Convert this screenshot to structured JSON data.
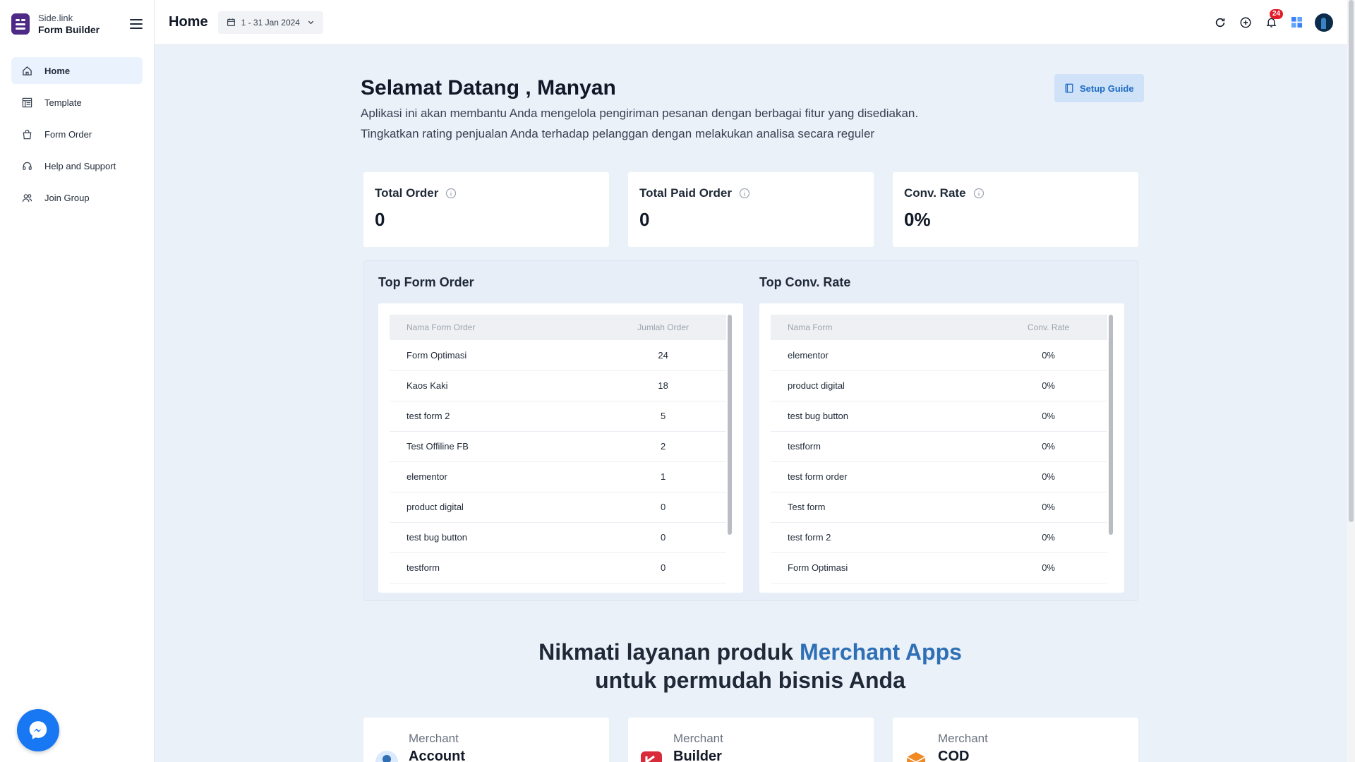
{
  "brand": {
    "line1": "Side.link",
    "line2": "Form Builder"
  },
  "sidebar": {
    "items": [
      {
        "label": "Home",
        "icon": "home-icon",
        "active": true
      },
      {
        "label": "Template",
        "icon": "template-icon"
      },
      {
        "label": "Form Order",
        "icon": "shopping-bag-icon"
      },
      {
        "label": "Help and Support",
        "icon": "headset-icon"
      },
      {
        "label": "Join Group",
        "icon": "users-icon"
      }
    ]
  },
  "header": {
    "title": "Home",
    "date_range": "1 - 31 Jan 2024",
    "notification_count": "24",
    "icons": [
      "refresh-icon",
      "plus-circle-icon",
      "bell-icon",
      "apps-grid-icon",
      "avatar"
    ]
  },
  "welcome": {
    "title": "Selamat Datang , Manyan",
    "line1": "Aplikasi ini akan membantu Anda mengelola pengiriman pesanan dengan berbagai fitur yang disediakan.",
    "line2": "Tingkatkan rating penjualan Anda terhadap pelanggan dengan melakukan analisa secara reguler",
    "setup_guide": "Setup Guide"
  },
  "stats": [
    {
      "label": "Total Order",
      "value": "0"
    },
    {
      "label": "Total Paid Order",
      "value": "0"
    },
    {
      "label": "Conv. Rate",
      "value": "0%"
    }
  ],
  "top_form_order": {
    "title": "Top Form Order",
    "columns": [
      "Nama Form Order",
      "Jumlah Order"
    ],
    "rows": [
      [
        "Form Optimasi",
        "24"
      ],
      [
        "Kaos Kaki",
        "18"
      ],
      [
        "test form 2",
        "5"
      ],
      [
        "Test Offiline FB",
        "2"
      ],
      [
        "elementor",
        "1"
      ],
      [
        "product digital",
        "0"
      ],
      [
        "test bug button",
        "0"
      ],
      [
        "testform",
        "0"
      ]
    ]
  },
  "top_conv_rate": {
    "title": "Top Conv. Rate",
    "columns": [
      "Nama Form",
      "Conv. Rate"
    ],
    "rows": [
      [
        "elementor",
        "0%"
      ],
      [
        "product digital",
        "0%"
      ],
      [
        "test bug button",
        "0%"
      ],
      [
        "testform",
        "0%"
      ],
      [
        "test form order",
        "0%"
      ],
      [
        "Test form",
        "0%"
      ],
      [
        "test form 2",
        "0%"
      ],
      [
        "Form Optimasi",
        "0%"
      ]
    ]
  },
  "promo": {
    "part1": "Nikmati layanan produk ",
    "accent": "Merchant Apps",
    "line2": "untuk permudah bisnis Anda"
  },
  "apps": [
    {
      "line1": "Merchant",
      "line2": "Account"
    },
    {
      "line1": "Merchant",
      "line2": "Builder"
    },
    {
      "line1": "Merchant",
      "line2": "COD"
    }
  ],
  "colors": {
    "accent": "#2e6fb5",
    "brand": "#4c2a85",
    "notif": "#e11d2a",
    "messenger": "#1877f2"
  }
}
